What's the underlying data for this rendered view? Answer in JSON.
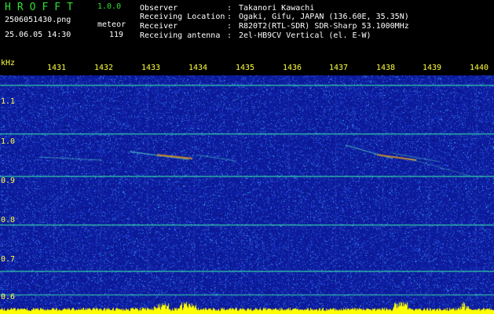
{
  "header": {
    "app_name": "HROFFT",
    "app_version": "1.0.0",
    "filename": "2506051430.png",
    "datetime": "25.06.05 14:30",
    "meteor_label": "meteor",
    "meteor_count": "119",
    "info": [
      {
        "label": "Observer",
        "value": "Takanori Kawachi"
      },
      {
        "label": "Receiving Location",
        "value": "Ogaki, Gifu, JAPAN (136.60E, 35.35N)"
      },
      {
        "label": "Receiver",
        "value": "R820T2(RTL-SDR) SDR-Sharp 53.1000MHz"
      },
      {
        "label": "Receiving antenna",
        "value": "2el-HB9CV Vertical (el. E-W)"
      }
    ]
  },
  "chart_data": {
    "type": "heatmap",
    "y_unit": "kHz",
    "x_ticks": [
      "1431",
      "1432",
      "1433",
      "1434",
      "1435",
      "1436",
      "1437",
      "1438",
      "1439",
      "1440"
    ],
    "y_ticks": [
      "1.1",
      "1.0",
      "0.9",
      "0.8",
      "0.7",
      "0.6"
    ],
    "xlim": [
      1430.5,
      1440.3
    ],
    "ylim": [
      0.58,
      1.18
    ],
    "carrier_lines_khz": [
      1.155,
      1.03,
      0.92,
      0.795,
      0.675,
      0.615
    ],
    "colors": {
      "background": "#0c1a9c",
      "line": "#38e6a8",
      "echo": "#c88a2a",
      "axis_text": "#ffff3c",
      "baseline": "#ffff00"
    }
  }
}
